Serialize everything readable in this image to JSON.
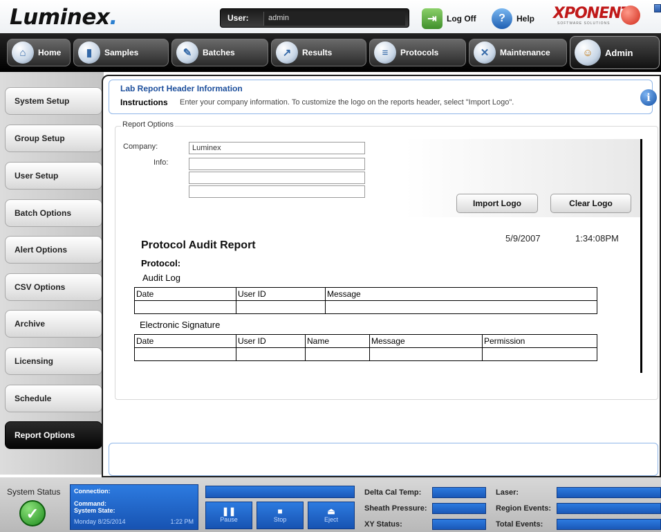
{
  "header": {
    "logo_text": "Luminex",
    "user_label": "User:",
    "user_value": "admin",
    "logoff_label": "Log Off",
    "help_label": "Help",
    "brand": "XPONENT",
    "brand_sub": "SOFTWARE SOLUTIONS"
  },
  "nav": {
    "tabs": [
      {
        "label": "Home",
        "icon": "home-icon"
      },
      {
        "label": "Samples",
        "icon": "samples-icon"
      },
      {
        "label": "Batches",
        "icon": "batches-icon"
      },
      {
        "label": "Results",
        "icon": "results-icon"
      },
      {
        "label": "Protocols",
        "icon": "protocols-icon"
      },
      {
        "label": "Maintenance",
        "icon": "maintenance-icon"
      },
      {
        "label": "Admin",
        "icon": "admin-icon"
      }
    ],
    "active": "Admin"
  },
  "sidebar": {
    "items": [
      {
        "label": "System Setup"
      },
      {
        "label": "Group Setup"
      },
      {
        "label": "User Setup"
      },
      {
        "label": "Batch Options"
      },
      {
        "label": "Alert Options"
      },
      {
        "label": "CSV Options"
      },
      {
        "label": "Archive"
      },
      {
        "label": "Licensing"
      },
      {
        "label": "Schedule"
      },
      {
        "label": "Report Options"
      }
    ],
    "active": "Report Options"
  },
  "main": {
    "title": "Lab Report Header Information",
    "instructions_label": "Instructions",
    "instructions_text": "Enter your company information. To customize the logo on the reports header, select \"Import Logo\".",
    "group_label": "Report Options",
    "company_label": "Company:",
    "company_value": "Luminex",
    "info_label": "Info:",
    "info_lines": [
      "",
      "",
      ""
    ],
    "import_logo": "Import Logo",
    "clear_logo": "Clear Logo",
    "report": {
      "date": "5/9/2007",
      "time": "1:34:08PM",
      "title": "Protocol Audit Report",
      "protocol_label": "Protocol:",
      "audit_log_label": "Audit Log",
      "audit_columns": [
        "Date",
        "User ID",
        "Message"
      ],
      "esig_label": "Electronic Signature",
      "esig_columns": [
        "Date",
        "User ID",
        "Name",
        "Message",
        "Permission"
      ]
    }
  },
  "status": {
    "system_status_label": "System Status",
    "connection_label": "Connection:",
    "command_label": "Command:",
    "system_state_label": "System State:",
    "date": "Monday 8/25/2014",
    "time": "1:22 PM",
    "pause_label": "Pause",
    "stop_label": "Stop",
    "eject_label": "Eject",
    "delta_cal_temp_label": "Delta Cal Temp:",
    "sheath_pressure_label": "Sheath Pressure:",
    "xy_status_label": "XY Status:",
    "laser_label": "Laser:",
    "region_events_label": "Region Events:",
    "total_events_label": "Total Events:"
  }
}
